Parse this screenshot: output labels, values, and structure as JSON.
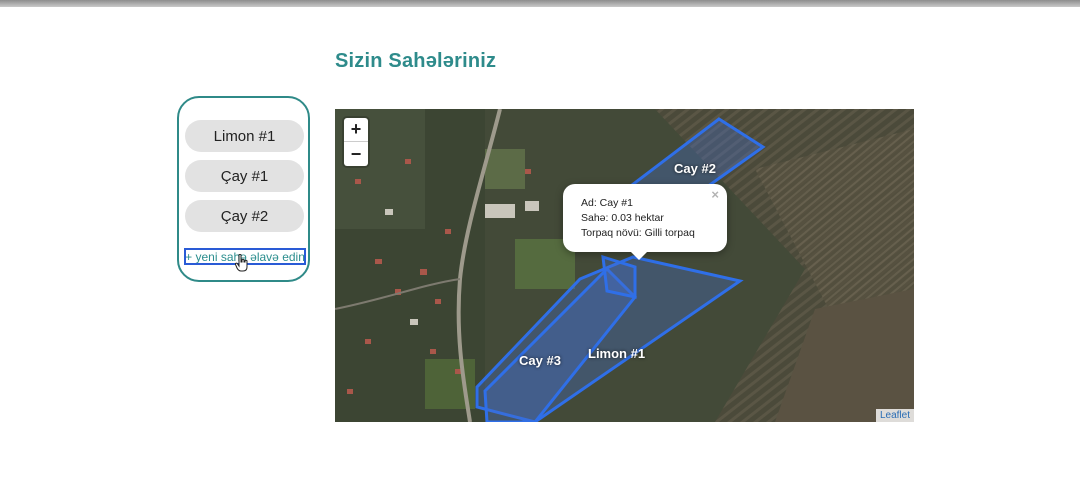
{
  "page": {
    "title": "Sizin Sahələriniz"
  },
  "field_list": {
    "items": [
      {
        "label": "Limon #1"
      },
      {
        "label": "Çay #1"
      },
      {
        "label": "Çay #2"
      }
    ],
    "add_label": "+ yeni sahə əlavə edin"
  },
  "map": {
    "zoom_in": "+",
    "zoom_out": "−",
    "polygon_labels": [
      "Cay #2",
      "Cay #3",
      "Limon #1"
    ],
    "popup": {
      "close": "×",
      "name_line": "Ad: Cay #1",
      "area_line": "Sahə: 0.03 hektar",
      "soil_line": "Torpaq növü: Gilli torpaq"
    },
    "attribution": "Leaflet",
    "polygon_color": "#2f6fe8"
  }
}
